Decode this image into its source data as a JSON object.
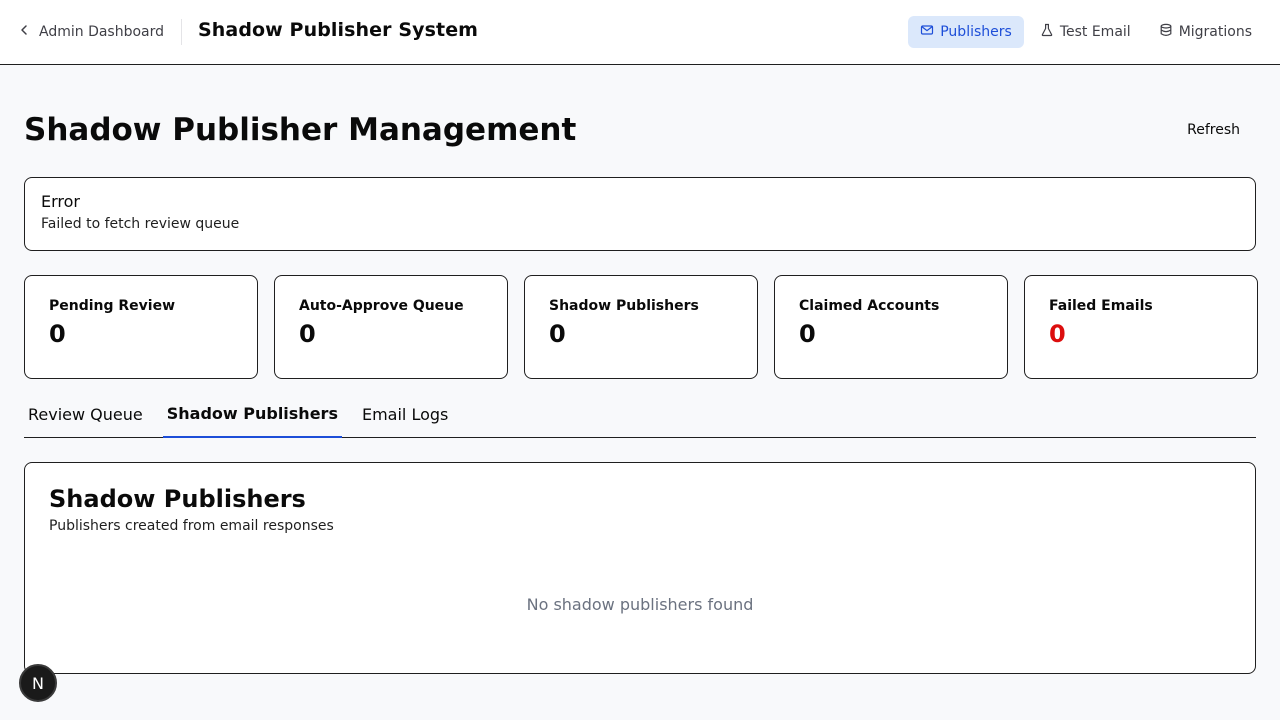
{
  "header": {
    "back_label": "Admin Dashboard",
    "app_title": "Shadow Publisher System",
    "nav": [
      {
        "label": "Publishers",
        "icon": "mail-icon",
        "active": true
      },
      {
        "label": "Test Email",
        "icon": "flask-icon",
        "active": false
      },
      {
        "label": "Migrations",
        "icon": "database-icon",
        "active": false
      }
    ]
  },
  "page": {
    "title": "Shadow Publisher Management",
    "refresh_label": "Refresh"
  },
  "error": {
    "title": "Error",
    "message": "Failed to fetch review queue"
  },
  "stats": [
    {
      "label": "Pending Review",
      "value": "0"
    },
    {
      "label": "Auto-Approve Queue",
      "value": "0"
    },
    {
      "label": "Shadow Publishers",
      "value": "0"
    },
    {
      "label": "Claimed Accounts",
      "value": "0"
    },
    {
      "label": "Failed Emails",
      "value": "0",
      "color": "#dc0e0e"
    }
  ],
  "tabs": [
    {
      "label": "Review Queue",
      "active": false
    },
    {
      "label": "Shadow Publishers",
      "active": true
    },
    {
      "label": "Email Logs",
      "active": false
    }
  ],
  "panel": {
    "title": "Shadow Publishers",
    "description": "Publishers created from email responses",
    "empty_text": "No shadow publishers found"
  },
  "badge": {
    "label": "N"
  },
  "colors": {
    "accent": "#1d4ed8",
    "accent_bg": "#dbe8fb",
    "danger": "#dc0e0e"
  }
}
